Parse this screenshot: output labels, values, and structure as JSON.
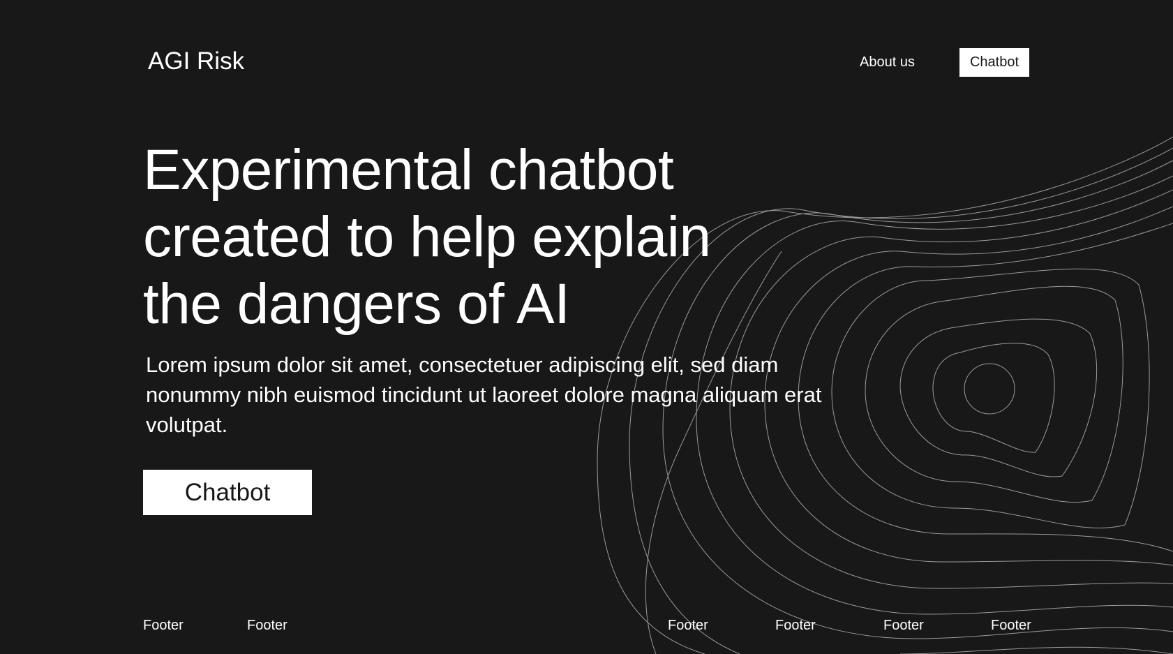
{
  "header": {
    "logo_text": "AGI Risk",
    "nav": {
      "about_label": "About us",
      "chatbot_label": "Chatbot"
    }
  },
  "hero": {
    "headline": "Experimental chatbot created to help explain the dangers of AI",
    "subtext": "Lorem ipsum dolor sit amet, consectetuer adipiscing elit, sed diam nonummy nibh euismod tincidunt ut laoreet dolore magna aliquam erat volutpat.",
    "cta_label": "Chatbot"
  },
  "footer": {
    "links": [
      "Footer",
      "Footer",
      "Footer",
      "Footer",
      "Footer",
      "Footer"
    ]
  },
  "colors": {
    "background": "#181818",
    "text": "#ffffff",
    "button_background": "#ffffff",
    "button_text": "#181818",
    "decor_lines": "#9a9a9a"
  }
}
